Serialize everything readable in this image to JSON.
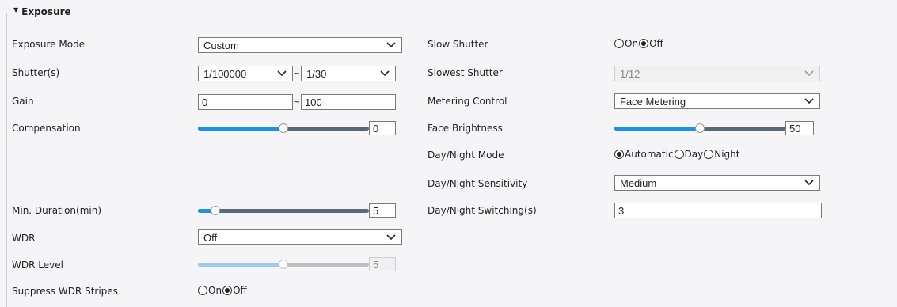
{
  "section": {
    "title": "Exposure"
  },
  "left": {
    "exposure_mode": {
      "label": "Exposure Mode",
      "value": "Custom"
    },
    "shutter": {
      "label": "Shutter(s)",
      "min_value": "1/100000",
      "separator": "~",
      "max_value": "1/30"
    },
    "gain": {
      "label": "Gain",
      "min_value": "0",
      "separator": "~",
      "max_value": "100"
    },
    "compensation": {
      "label": "Compensation",
      "value": "0",
      "level": 0.5
    },
    "min_duration": {
      "label": "Min. Duration(min)",
      "value": "5",
      "level": 0.1
    },
    "wdr": {
      "label": "WDR",
      "value": "Off"
    },
    "wdr_level": {
      "label": "WDR Level",
      "value": "5",
      "level": 0.5
    },
    "suppress_wdr": {
      "label": "Suppress WDR Stripes",
      "options": [
        "On",
        "Off"
      ],
      "selected": "Off"
    }
  },
  "right": {
    "slow_shutter": {
      "label": "Slow Shutter",
      "options": [
        "On",
        "Off"
      ],
      "selected": "Off"
    },
    "slowest_shutter": {
      "label": "Slowest Shutter",
      "value": "1/12"
    },
    "metering_control": {
      "label": "Metering Control",
      "value": "Face Metering"
    },
    "face_brightness": {
      "label": "Face Brightness",
      "value": "50",
      "level": 0.5
    },
    "day_night_mode": {
      "label": "Day/Night Mode",
      "options": [
        "Automatic",
        "Day",
        "Night"
      ],
      "selected": "Automatic"
    },
    "day_night_sensitivity": {
      "label": "Day/Night Sensitivity",
      "value": "Medium"
    },
    "day_night_switching": {
      "label": "Day/Night Switching(s)",
      "value": "3"
    }
  },
  "colors": {
    "accent": "#1e90e8",
    "track": "#5b6877",
    "background": "#f5f5f7"
  }
}
